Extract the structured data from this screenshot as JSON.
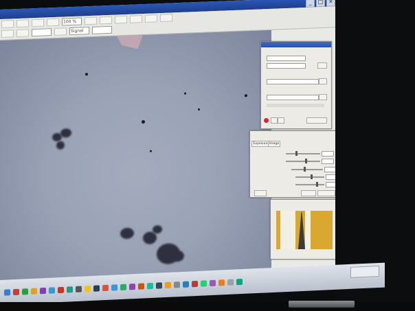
{
  "window": {
    "controls": [
      "_",
      "□",
      "×"
    ]
  },
  "toolbar": {
    "zoom_value": "100 %",
    "row2_field": "Signal"
  },
  "capture_dialog": {},
  "camera_dialog": {
    "tab1": "Exposure",
    "tab2": "Image"
  },
  "histogram_dialog": {},
  "taskbar": {
    "icon_colors": [
      "#3a7bd5",
      "#d33a2c",
      "#2d9c3c",
      "#e0a020",
      "#7a42b5",
      "#2a9fd6",
      "#c0392b",
      "#16a085",
      "#555555",
      "#f1c40f",
      "#2c3e50",
      "#e74c3c",
      "#3498db",
      "#27ae60",
      "#8e44ad",
      "#d35400",
      "#1abc9c",
      "#34495e",
      "#f39c12",
      "#7f8c8d",
      "#2980b9",
      "#c0392b",
      "#2ecc71",
      "#9b59b6",
      "#e67e22",
      "#95a5a6",
      "#16a085"
    ]
  }
}
